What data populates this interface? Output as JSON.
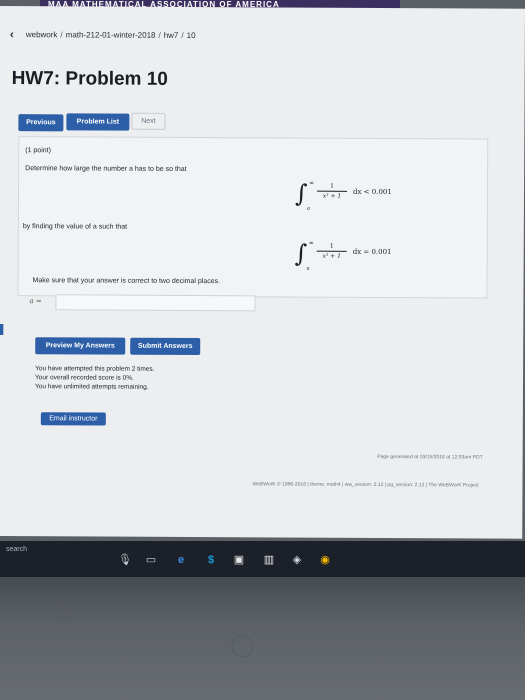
{
  "banner": {
    "text": "MAA MATHEMATICAL ASSOCIATION OF AMERICA"
  },
  "breadcrumb": {
    "items": [
      "webwork",
      "math-212-01-winter-2018",
      "hw7",
      "10"
    ],
    "separator": "/"
  },
  "page": {
    "title": "HW7: Problem 10"
  },
  "nav": {
    "previous": "Previous",
    "problem_list": "Problem List",
    "next": "Next"
  },
  "problem": {
    "points": "(1 point)",
    "question": "Determine how large the number a has to be so that",
    "inequality": {
      "upper": "∞",
      "lower": "a",
      "numerator": "1",
      "denominator": "x² + 1",
      "relation": "dx < 0.001"
    },
    "find_text": "by finding the value of a such that",
    "equation": {
      "upper": "∞",
      "lower": "a",
      "numerator": "1",
      "denominator": "x² + 1",
      "relation": "dx = 0.001"
    },
    "instruction": "Make sure that your answer is correct to two decimal places."
  },
  "answer": {
    "label": "a =",
    "value": ""
  },
  "actions": {
    "preview": "Preview My Answers",
    "submit": "Submit Answers",
    "email": "Email instructor"
  },
  "status": {
    "attempts": "You have attempted this problem 2 times.",
    "score": "Your overall recorded score is 0%.",
    "remaining": "You have unlimited attempts remaining."
  },
  "footer": {
    "generated": "Page generated at 03/15/2018 at 12:03am PDT",
    "copyright": "WeBWorK © 1996-2016 | theme: math4 | ww_version: 2.12 | pg_version: 2.12 | The WeBWorK Project"
  },
  "taskbar": {
    "search": "search"
  }
}
